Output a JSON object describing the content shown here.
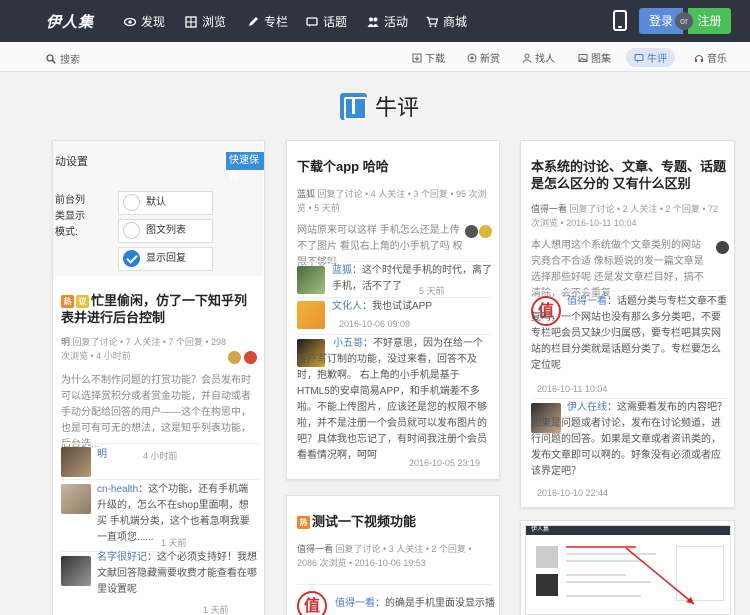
{
  "nav": {
    "logo": "伊人集",
    "items": [
      {
        "label": "发现",
        "icon": "eye-icon"
      },
      {
        "label": "浏览",
        "icon": "grid-icon"
      },
      {
        "label": "专栏",
        "icon": "pen-icon"
      },
      {
        "label": "话题",
        "icon": "chat-icon"
      },
      {
        "label": "活动",
        "icon": "people-icon"
      },
      {
        "label": "商城",
        "icon": "cart-icon"
      }
    ],
    "login": "登录",
    "or": "or",
    "register": "注册"
  },
  "subnav": {
    "search": "搜索",
    "categories": [
      {
        "label": "下载",
        "icon": "download-icon"
      },
      {
        "label": "新赏",
        "icon": "circle-icon"
      },
      {
        "label": "找人",
        "icon": "person-icon"
      },
      {
        "label": "图集",
        "icon": "image-icon"
      },
      {
        "label": "牛评",
        "icon": "comment-icon",
        "active": true
      },
      {
        "label": "音乐",
        "icon": "headphones-icon"
      }
    ]
  },
  "page_title": "牛评",
  "thumb_settings": {
    "head": "动设置",
    "save_button": "快速保存",
    "labels": [
      "前台列",
      "类显示",
      "模式:"
    ],
    "options": [
      "默认",
      "图文列表",
      "显示回复"
    ]
  },
  "cards": [
    {
      "title": "忙里偷闲，仿了一下知乎列表并进行后台控制",
      "badges": [
        "热",
        "议"
      ],
      "meta_user": "明",
      "meta_rest": "回复了讨论 • 7 人关注 • 7 个回复 • 298 次浏览",
      "meta_time": "• 4 小时前",
      "summary": "为什么不制作问题的打赏功能？会员发布时可以选择赏积分或者赏金功能，并自动或者手动分配给回答的用户——这个在构思中，也是可有可无的想法，这是知乎列表功能，后台选...",
      "comments": [
        {
          "user": "明",
          "text": "",
          "time": "4 小时前"
        },
        {
          "user": "cn-health",
          "text": "这个功能，还有手机端升级的，怎么不在shop里面啊，想买 手机端分类，这个也着急啊我要一直项您......",
          "time": "1 天前"
        },
        {
          "user": "名字很好记",
          "text": "这个必须支持好！我想文献回答隐藏需要收费才能查看在哪里设置呢",
          "time": "1 天前"
        }
      ]
    },
    {
      "title": "下载个app 哈哈",
      "meta_user": "蓝狐",
      "meta_rest": "回复了讨论 • 4 人关注 • 3 个回复 • 95 次浏览",
      "meta_time": "• 5 天前",
      "summary": "网站原来可以这样 手机怎么还是上传不了图片 看见右上角的小手机了吗 权限不够吗",
      "comments": [
        {
          "user": "蓝狐",
          "text": "这个时代是手机的时代，离了手机，活不了了",
          "time": "5 天前"
        },
        {
          "user": "文化人",
          "text": "我也试试APP",
          "time": "2016-10-06 09:09"
        },
        {
          "user": "小五哥",
          "text": "不好意思，因为在给一个客户写订制的功能，没过来看，回答不及时，抱歉啊。 右上角的小手机是基于HTML5的安卓简易APP，和手机端差不多啦。不能上传图片，应该还是您的权限不够啦，并不是注册一个会员就可以发布图片的吧？具体我也忘记了，有时间我注册个会员看看情况啊，呵呵",
          "time": "2016-10-05 23:19"
        }
      ]
    },
    {
      "title": "测试一下视频功能",
      "badges": [
        "热"
      ],
      "meta_user": "值得一看",
      "meta_rest": "回复了讨论 • 3 人关注 • 2 个回复 • 2086 次浏览 • 2016-10-06 19:53",
      "comment_user": "值得一看",
      "comment_text": "的确是手机里面没显示播"
    },
    {
      "title": "本系统的讨论、文章、专题、话题是怎么区分的 又有什么区别",
      "meta_user": "值得一看",
      "meta_rest": "回复了讨论 • 2 人关注 • 2 个回复 • 72 次浏览 • 2016-10-11 10:04",
      "summary": "本人想用这个系统做个文章类别的网站 究竟合不合适 像标题说的发一篇文章是选择那些好呢 还是发文章栏目好，搞不清除，会不会重复",
      "comments": [
        {
          "user": "值得一看",
          "text": "话题分类与专栏文章不重复吗，一个网站也没有那么多分类吧，不要专栏吧会员又缺少归属感，要专栏吧其实网站的栏目分类就是话题分类了。专栏要怎么定位呢",
          "time": "2016-10-11 10:04"
        },
        {
          "user": "伊人在线",
          "text": "这需要看发布的内容吧？如果是问题或者讨论，发布在讨论频道，进行问题的回答。如果是文章或者资讯类的，发布文章即可以啊的。好象没有必须或者应该界定吧？",
          "time": "2016-10-10 22:44"
        }
      ]
    }
  ],
  "shot_logo": "伊人集"
}
